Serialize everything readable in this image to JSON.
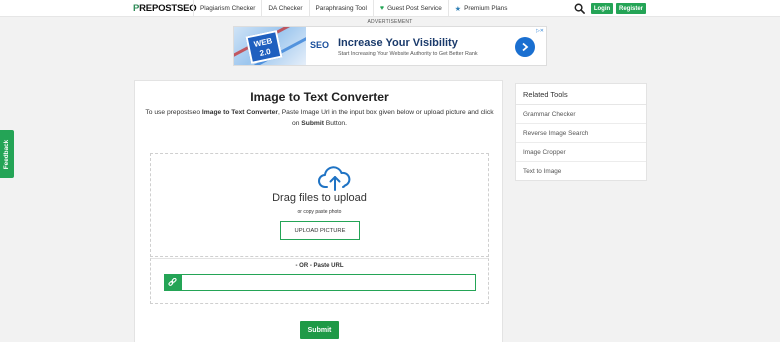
{
  "header": {
    "logo": "REPOSTSEO",
    "logo_first": "P",
    "nav": [
      {
        "label": "Plagiarism Checker"
      },
      {
        "label": "DA Checker"
      },
      {
        "label": "Paraphrasing Tool"
      },
      {
        "label": "Guest Post Service",
        "icon": "heart-icon"
      },
      {
        "label": "Premium Plans",
        "icon": "star-icon"
      }
    ],
    "login": "Login",
    "register": "Register",
    "accent": "#24a456"
  },
  "ad": {
    "label": "ADVERTISEMENT",
    "badge": "WEB 2.0",
    "seo": "SEO",
    "title": "Increase Your Visibility",
    "subtitle": "Start Increasing Your Website Authority to Get Better Rank"
  },
  "feedback": "Feedback",
  "main": {
    "title": "Image to Text Converter",
    "desc_1": "To use prepostseo ",
    "desc_b1": "Image to Text Converter",
    "desc_2": ", Paste Image Url in the input box given below or upload picture and click on ",
    "desc_b2": "Submit",
    "desc_3": " Button.",
    "drag": "Drag files to upload",
    "copy_paste": "or copy paste photo",
    "upload": "UPLOAD PICTURE",
    "or_label": "- OR - Paste URL",
    "url_value": "",
    "submit": "Submit"
  },
  "sidebar": {
    "title": "Related Tools",
    "items": [
      {
        "label": "Grammar Checker"
      },
      {
        "label": "Reverse Image Search"
      },
      {
        "label": "Image Cropper"
      },
      {
        "label": "Text to Image"
      }
    ]
  }
}
